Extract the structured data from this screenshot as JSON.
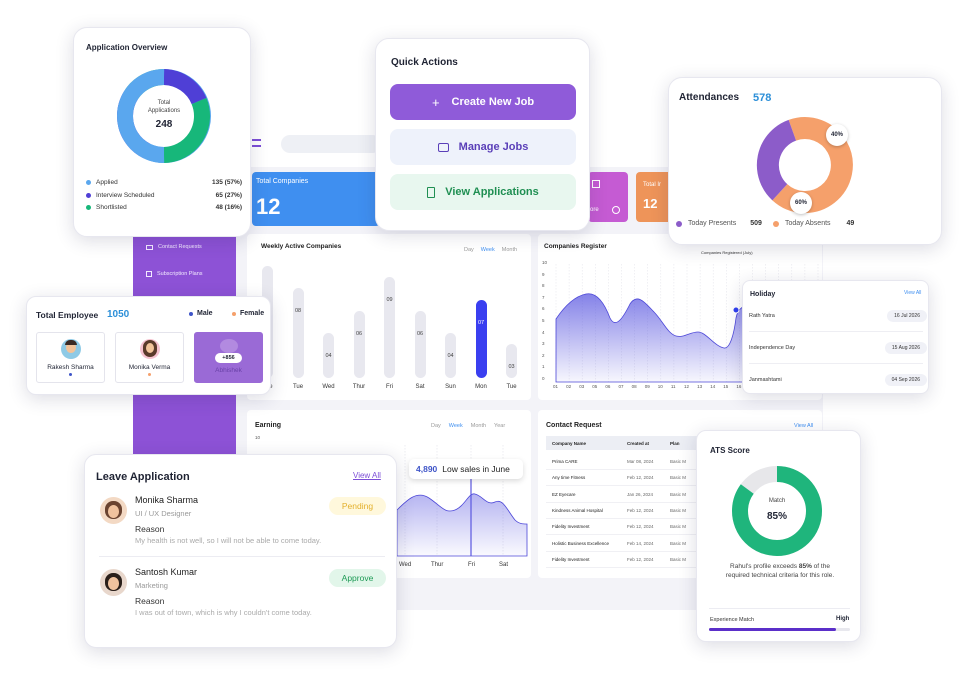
{
  "overview": {
    "title": "Application Overview",
    "center_label": "Total\nApplications",
    "center_value": "248",
    "legend": [
      {
        "label": "Applied",
        "value": "135 (57%)",
        "color": "#5aa7ee"
      },
      {
        "label": "Interview Scheduled",
        "value": "65 (27%)",
        "color": "#4f3fd6"
      },
      {
        "label": "Shortlisted",
        "value": "48 (16%)",
        "color": "#17b77a"
      }
    ]
  },
  "quick_actions": {
    "title": "Quick Actions",
    "create_label": "Create New Job",
    "manage_label": "Manage Jobs",
    "view_label": "View Applications"
  },
  "attendance": {
    "title": "Attendances",
    "total": "578",
    "present_label": "Today Presents",
    "present_value": "509",
    "absent_label": "Today Absents",
    "absent_value": "49",
    "absent_pct": "40%",
    "present_pct": "60%",
    "colors": {
      "present": "#8c5cc9",
      "absent": "#f5a06b"
    }
  },
  "dashboard": {
    "tiles": {
      "total_companies_label": "Total Companies",
      "total_companies_value": "12",
      "tile2_label": "Total Ir",
      "tile2_value": "12",
      "more_label": "ore"
    },
    "sidebar": {
      "contact_requests": "Contact Requests",
      "subscription_plans": "Subscription Plans"
    },
    "weekly": {
      "title": "Weekly Active Companies",
      "tabs": [
        "Day",
        "Week",
        "Month"
      ],
      "days": [
        "Tue",
        "Tue",
        "Wed",
        "Thur",
        "Fri",
        "Sat",
        "Sun",
        "Mon",
        "Tue"
      ],
      "values": [
        10,
        8,
        4,
        6,
        9,
        6,
        4,
        7,
        3
      ],
      "value_labels": [
        "",
        "08",
        "04",
        "06",
        "09",
        "06",
        "04",
        "07",
        "03"
      ]
    },
    "register": {
      "title": "Companies Register",
      "tooltip": "Companies Registered (July)",
      "y_ticks": [
        "10",
        "9",
        "8",
        "7",
        "6",
        "5",
        "4",
        "3",
        "2",
        "1",
        "0"
      ],
      "x_ticks": [
        "01",
        "02",
        "03",
        "05",
        "06",
        "07",
        "08",
        "09",
        "10",
        "11",
        "12",
        "13",
        "14",
        "15",
        "16",
        "17",
        "18",
        "19",
        "20",
        "21",
        "22"
      ]
    },
    "earning": {
      "title": "Earning",
      "tabs": [
        "Day",
        "Week",
        "Month",
        "Year"
      ],
      "y_tick": "10",
      "days": [
        "Wed",
        "Thur",
        "Fri",
        "Sat"
      ],
      "tooltip_value": "4,890",
      "tooltip_text": "Low sales in June"
    },
    "contact": {
      "title": "Contact Request",
      "view_all": "View All",
      "headers": [
        "Company Name",
        "Created at",
        "Plan"
      ],
      "rows": [
        [
          "Prima CARE",
          "Mar 08, 2024",
          "Basic M"
        ],
        [
          "Any time Fitness",
          "Feb 12, 2024",
          "Basic M"
        ],
        [
          "EZ Eyecare",
          "Jan 26, 2024",
          "Basic M"
        ],
        [
          "Kindness Animal Hospital",
          "Feb 12, 2024",
          "Basic M"
        ],
        [
          "Fidelity Investment",
          "Feb 12, 2024",
          "Basic M"
        ],
        [
          "Holistic Business Excellence",
          "Feb 14, 2024",
          "Basic M"
        ],
        [
          "Fidelity Investment",
          "Feb 12, 2024",
          "Basic M"
        ]
      ]
    }
  },
  "employee": {
    "title": "Total Employee",
    "count": "1050",
    "male_label": "Male",
    "female_label": "Female",
    "people": [
      {
        "name": "Rakesh Sharma"
      },
      {
        "name": "Monika Verma"
      },
      {
        "name": "Abhishek",
        "badge": "+856"
      }
    ]
  },
  "holiday": {
    "title": "Holiday",
    "view_all": "View All",
    "items": [
      {
        "name": "Rath Yatra",
        "date": "16 Jul 2026"
      },
      {
        "name": "Independence Day",
        "date": "15 Aug 2026"
      },
      {
        "name": "Janmashtami",
        "date": "04 Sep 2026"
      }
    ]
  },
  "leave": {
    "title": "Leave Application",
    "view_all": "View All",
    "reason_label": "Reason",
    "items": [
      {
        "name": "Monika Sharma",
        "role": "UI / UX Designer",
        "status": "Pending",
        "reason": "My health is not well, so I will not be able to come today."
      },
      {
        "name": "Santosh Kumar",
        "role": "Marketing",
        "status": "Approve",
        "reason": "I was out of town, which is why I couldn't come today."
      }
    ]
  },
  "ats": {
    "title": "ATS Score",
    "match_label": "Match",
    "percent": "85%",
    "score": 0.85,
    "desc_pre": "Rahul's profile exceeds ",
    "desc_bold": "85%",
    "desc_post": " of the required technical criteria for this role.",
    "exp_label": "Experience Match",
    "exp_level": "High",
    "exp_fill": 0.9
  }
}
